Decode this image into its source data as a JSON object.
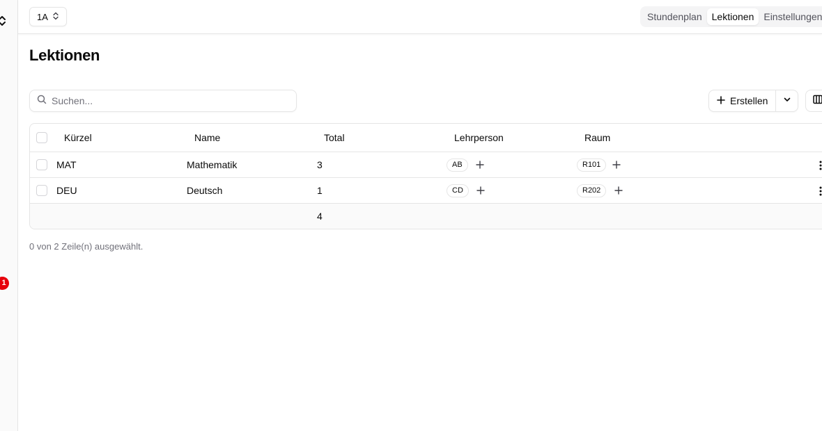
{
  "sidebar": {
    "notification_count": "1"
  },
  "header": {
    "class_select_value": "1A",
    "tabs": [
      {
        "label": "Stundenplan",
        "active": false
      },
      {
        "label": "Lektionen",
        "active": true
      },
      {
        "label": "Einstellungen",
        "active": false
      }
    ]
  },
  "page": {
    "title": "Lektionen"
  },
  "toolbar": {
    "search_placeholder": "Suchen...",
    "search_value": "",
    "create_label": "Erstellen"
  },
  "table": {
    "headers": [
      "Kürzel",
      "Name",
      "Total",
      "Lehrperson",
      "Raum"
    ],
    "rows": [
      {
        "code": "MAT",
        "name": "Mathematik",
        "total": "3",
        "teacher": "AB",
        "room": "R101"
      },
      {
        "code": "DEU",
        "name": "Deutsch",
        "total": "1",
        "teacher": "CD",
        "room": "R202"
      }
    ],
    "footer_total": "4"
  },
  "selection_status": "0 von 2 Zeile(n) ausgewählt.",
  "colors": {
    "border": "#e5e5e5",
    "muted_text": "#71717a",
    "badge": "#e7000b",
    "tab_bg": "#f4f4f5"
  }
}
